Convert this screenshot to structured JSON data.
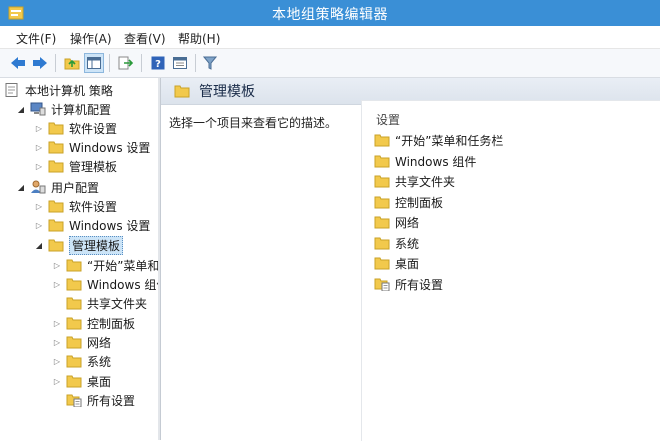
{
  "window": {
    "title": "本地组策略编辑器"
  },
  "menu": [
    "文件(F)",
    "操作(A)",
    "查看(V)",
    "帮助(H)"
  ],
  "toolbar": {
    "buttons": [
      {
        "icon": "back-arrow-icon"
      },
      {
        "icon": "forward-arrow-icon"
      },
      {
        "icon": "up-folder-icon"
      },
      {
        "icon": "show-hide-tree-icon",
        "active": true
      },
      {
        "icon": "export-list-icon"
      },
      {
        "icon": "help-icon"
      },
      {
        "icon": "properties-icon"
      },
      {
        "icon": "filter-icon"
      }
    ]
  },
  "tree": {
    "root": "本地计算机 策略",
    "computer_config": "计算机配置",
    "computer_items": [
      "软件设置",
      "Windows 设置",
      "管理模板"
    ],
    "user_config": "用户配置",
    "user_items": [
      "软件设置",
      "Windows 设置",
      "管理模板"
    ],
    "admin_templates_children": [
      "“开始”菜单和",
      "Windows 组件",
      "共享文件夹",
      "控制面板",
      "网络",
      "系统",
      "桌面",
      "所有设置"
    ]
  },
  "right_pane": {
    "header": "管理模板",
    "description": "选择一个项目来查看它的描述。",
    "column_header": "设置",
    "items": [
      "“开始”菜单和任务栏",
      "Windows 组件",
      "共享文件夹",
      "控制面板",
      "网络",
      "系统",
      "桌面",
      "所有设置"
    ]
  },
  "colors": {
    "title_bar": "#3a8fd6",
    "folder": "#f2c94c",
    "selection": "#cce4f7"
  }
}
